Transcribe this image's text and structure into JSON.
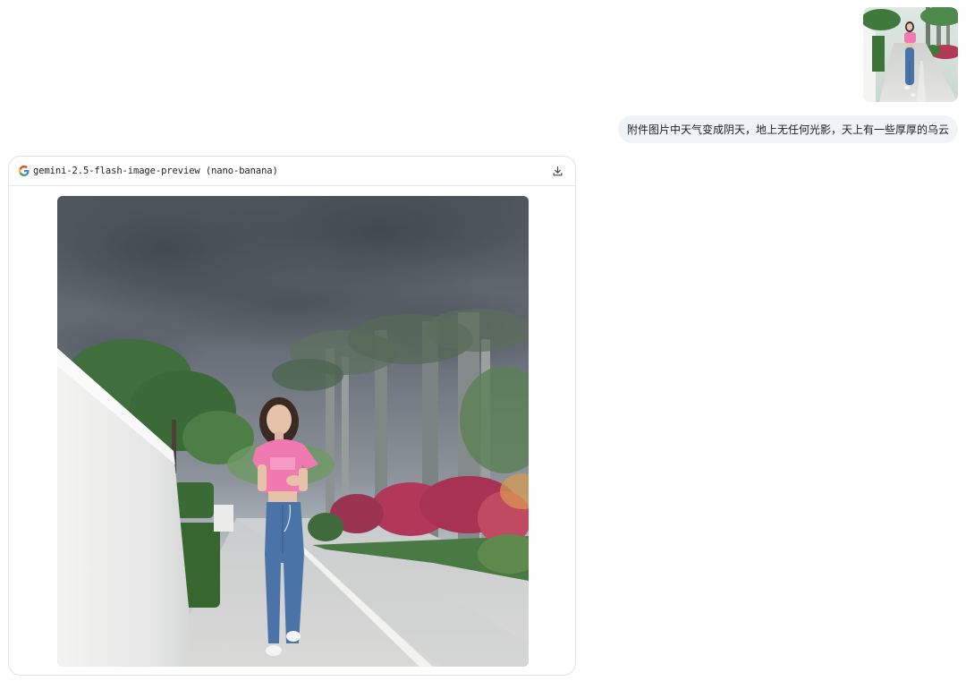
{
  "user_message": {
    "text": "附件图片中天气变成阴天，地上无任何光影，天上有一些厚厚的乌云",
    "attachment_icon": "photo-thumbnail"
  },
  "response": {
    "model_name": "gemini-2.5-flash-image-preview (nano-banana)",
    "provider_icon": "google-g-icon",
    "download_icon": "download-icon"
  },
  "colors": {
    "bubble_bg": "#f0f4f9",
    "card_border": "#dde3ea",
    "shirt_pink": "#f07ab0",
    "jeans_blue": "#4a74a8",
    "storm_sky": "#5f6670"
  }
}
